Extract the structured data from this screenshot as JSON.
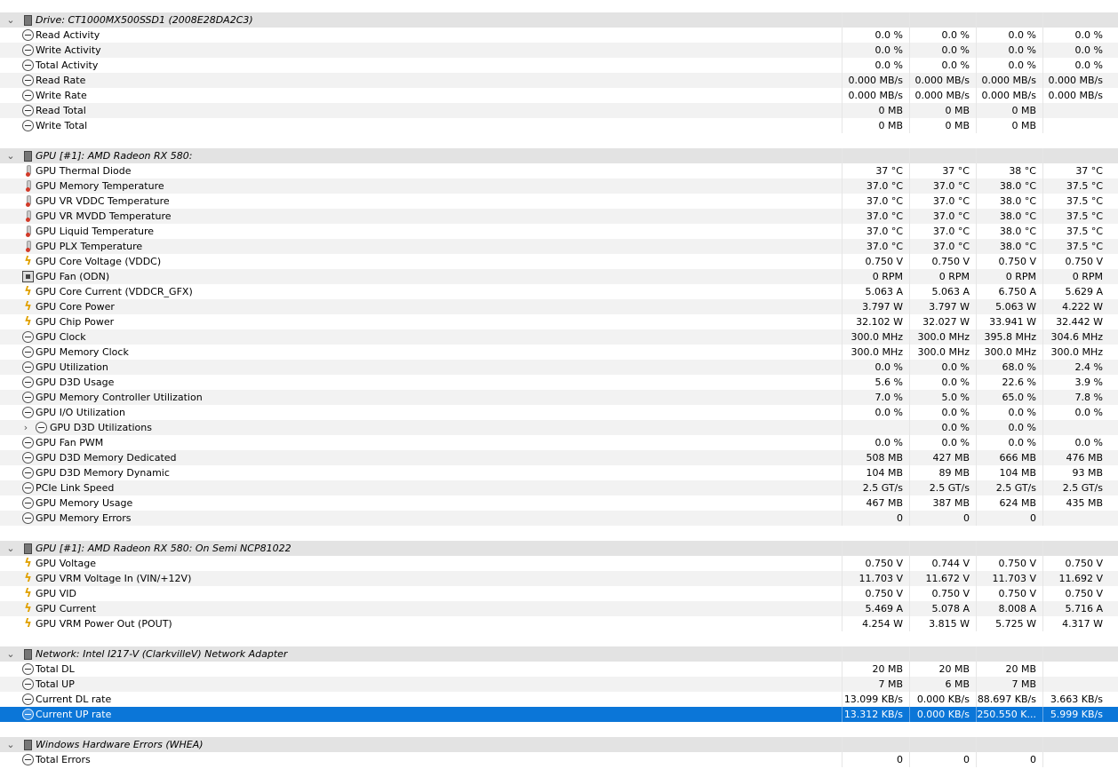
{
  "table": {
    "rows": [
      {
        "type": "group",
        "label": "Drive: CT1000MX500SSD1 (2008E28DA2C3)",
        "icon": "drive-icon",
        "values": [
          "",
          "",
          "",
          ""
        ]
      },
      {
        "type": "item",
        "label": "Read Activity",
        "icon": "gauge-icon",
        "values": [
          "0.0 %",
          "0.0 %",
          "0.0 %",
          "0.0 %"
        ]
      },
      {
        "type": "item",
        "label": "Write Activity",
        "icon": "gauge-icon",
        "values": [
          "0.0 %",
          "0.0 %",
          "0.0 %",
          "0.0 %"
        ]
      },
      {
        "type": "item",
        "label": "Total Activity",
        "icon": "gauge-icon",
        "values": [
          "0.0 %",
          "0.0 %",
          "0.0 %",
          "0.0 %"
        ]
      },
      {
        "type": "item",
        "label": "Read Rate",
        "icon": "gauge-icon",
        "values": [
          "0.000 MB/s",
          "0.000 MB/s",
          "0.000 MB/s",
          "0.000 MB/s"
        ]
      },
      {
        "type": "item",
        "label": "Write Rate",
        "icon": "gauge-icon",
        "values": [
          "0.000 MB/s",
          "0.000 MB/s",
          "0.000 MB/s",
          "0.000 MB/s"
        ]
      },
      {
        "type": "item",
        "label": "Read Total",
        "icon": "gauge-icon",
        "values": [
          "0 MB",
          "0 MB",
          "0 MB",
          ""
        ]
      },
      {
        "type": "item",
        "label": "Write Total",
        "icon": "gauge-icon",
        "values": [
          "0 MB",
          "0 MB",
          "0 MB",
          ""
        ]
      },
      {
        "type": "blank"
      },
      {
        "type": "group",
        "label": "GPU [#1]: AMD Radeon RX 580:",
        "icon": "gpu-chip-icon",
        "values": [
          "",
          "",
          "",
          ""
        ]
      },
      {
        "type": "item",
        "label": "GPU Thermal Diode",
        "icon": "thermometer-icon",
        "values": [
          "37 °C",
          "37 °C",
          "38 °C",
          "37 °C"
        ]
      },
      {
        "type": "item",
        "label": "GPU Memory Temperature",
        "icon": "thermometer-icon",
        "values": [
          "37.0 °C",
          "37.0 °C",
          "38.0 °C",
          "37.5 °C"
        ]
      },
      {
        "type": "item",
        "label": "GPU VR VDDC Temperature",
        "icon": "thermometer-icon",
        "values": [
          "37.0 °C",
          "37.0 °C",
          "38.0 °C",
          "37.5 °C"
        ]
      },
      {
        "type": "item",
        "label": "GPU VR MVDD Temperature",
        "icon": "thermometer-icon",
        "values": [
          "37.0 °C",
          "37.0 °C",
          "38.0 °C",
          "37.5 °C"
        ]
      },
      {
        "type": "item",
        "label": "GPU Liquid Temperature",
        "icon": "thermometer-icon",
        "values": [
          "37.0 °C",
          "37.0 °C",
          "38.0 °C",
          "37.5 °C"
        ]
      },
      {
        "type": "item",
        "label": "GPU PLX Temperature",
        "icon": "thermometer-icon",
        "values": [
          "37.0 °C",
          "37.0 °C",
          "38.0 °C",
          "37.5 °C"
        ]
      },
      {
        "type": "item",
        "label": "GPU Core Voltage (VDDC)",
        "icon": "bolt-icon",
        "values": [
          "0.750 V",
          "0.750 V",
          "0.750 V",
          "0.750 V"
        ]
      },
      {
        "type": "item",
        "label": "GPU Fan (ODN)",
        "icon": "fan-icon",
        "values": [
          "0 RPM",
          "0 RPM",
          "0 RPM",
          "0 RPM"
        ]
      },
      {
        "type": "item",
        "label": "GPU Core Current (VDDCR_GFX)",
        "icon": "bolt-icon",
        "values": [
          "5.063 A",
          "5.063 A",
          "6.750 A",
          "5.629 A"
        ]
      },
      {
        "type": "item",
        "label": "GPU Core Power",
        "icon": "bolt-icon",
        "values": [
          "3.797 W",
          "3.797 W",
          "5.063 W",
          "4.222 W"
        ]
      },
      {
        "type": "item",
        "label": "GPU Chip Power",
        "icon": "bolt-icon",
        "values": [
          "32.102 W",
          "32.027 W",
          "33.941 W",
          "32.442 W"
        ]
      },
      {
        "type": "item",
        "label": "GPU Clock",
        "icon": "gauge-icon",
        "values": [
          "300.0 MHz",
          "300.0 MHz",
          "395.8 MHz",
          "304.6 MHz"
        ]
      },
      {
        "type": "item",
        "label": "GPU Memory Clock",
        "icon": "gauge-icon",
        "values": [
          "300.0 MHz",
          "300.0 MHz",
          "300.0 MHz",
          "300.0 MHz"
        ]
      },
      {
        "type": "item",
        "label": "GPU Utilization",
        "icon": "gauge-icon",
        "values": [
          "0.0 %",
          "0.0 %",
          "68.0 %",
          "2.4 %"
        ]
      },
      {
        "type": "item",
        "label": "GPU D3D Usage",
        "icon": "gauge-icon",
        "values": [
          "5.6 %",
          "0.0 %",
          "22.6 %",
          "3.9 %"
        ]
      },
      {
        "type": "item",
        "label": "GPU Memory Controller Utilization",
        "icon": "gauge-icon",
        "values": [
          "7.0 %",
          "5.0 %",
          "65.0 %",
          "7.8 %"
        ]
      },
      {
        "type": "item",
        "label": "GPU I/O Utilization",
        "icon": "gauge-icon",
        "values": [
          "0.0 %",
          "0.0 %",
          "0.0 %",
          "0.0 %"
        ]
      },
      {
        "type": "sub",
        "label": "GPU D3D Utilizations",
        "icon": "gauge-icon",
        "values": [
          "",
          "0.0 %",
          "0.0 %",
          ""
        ]
      },
      {
        "type": "item",
        "label": "GPU Fan PWM",
        "icon": "gauge-icon",
        "values": [
          "0.0 %",
          "0.0 %",
          "0.0 %",
          "0.0 %"
        ]
      },
      {
        "type": "item",
        "label": "GPU D3D Memory Dedicated",
        "icon": "gauge-icon",
        "values": [
          "508 MB",
          "427 MB",
          "666 MB",
          "476 MB"
        ]
      },
      {
        "type": "item",
        "label": "GPU D3D Memory Dynamic",
        "icon": "gauge-icon",
        "values": [
          "104 MB",
          "89 MB",
          "104 MB",
          "93 MB"
        ]
      },
      {
        "type": "item",
        "label": "PCIe Link Speed",
        "icon": "gauge-icon",
        "values": [
          "2.5 GT/s",
          "2.5 GT/s",
          "2.5 GT/s",
          "2.5 GT/s"
        ]
      },
      {
        "type": "item",
        "label": "GPU Memory Usage",
        "icon": "gauge-icon",
        "values": [
          "467 MB",
          "387 MB",
          "624 MB",
          "435 MB"
        ]
      },
      {
        "type": "item",
        "label": "GPU Memory Errors",
        "icon": "gauge-icon",
        "values": [
          "0",
          "0",
          "0",
          ""
        ]
      },
      {
        "type": "blank"
      },
      {
        "type": "group",
        "label": "GPU [#1]: AMD Radeon RX 580: On Semi NCP81022",
        "icon": "gpu-chip-icon",
        "values": [
          "",
          "",
          "",
          ""
        ]
      },
      {
        "type": "item",
        "label": "GPU Voltage",
        "icon": "bolt-icon",
        "values": [
          "0.750 V",
          "0.744 V",
          "0.750 V",
          "0.750 V"
        ]
      },
      {
        "type": "item",
        "label": "GPU VRM Voltage In (VIN/+12V)",
        "icon": "bolt-icon",
        "values": [
          "11.703 V",
          "11.672 V",
          "11.703 V",
          "11.692 V"
        ]
      },
      {
        "type": "item",
        "label": "GPU VID",
        "icon": "bolt-icon",
        "values": [
          "0.750 V",
          "0.750 V",
          "0.750 V",
          "0.750 V"
        ]
      },
      {
        "type": "item",
        "label": "GPU Current",
        "icon": "bolt-icon",
        "values": [
          "5.469 A",
          "5.078 A",
          "8.008 A",
          "5.716 A"
        ]
      },
      {
        "type": "item",
        "label": "GPU VRM Power Out (POUT)",
        "icon": "bolt-icon",
        "values": [
          "4.254 W",
          "3.815 W",
          "5.725 W",
          "4.317 W"
        ]
      },
      {
        "type": "blank"
      },
      {
        "type": "group",
        "label": "Network: Intel I217-V (ClarkvilleV) Network Adapter",
        "icon": "network-icon",
        "values": [
          "",
          "",
          "",
          ""
        ]
      },
      {
        "type": "item",
        "label": "Total DL",
        "icon": "gauge-icon",
        "values": [
          "20 MB",
          "20 MB",
          "20 MB",
          ""
        ]
      },
      {
        "type": "item",
        "label": "Total UP",
        "icon": "gauge-icon",
        "values": [
          "7 MB",
          "6 MB",
          "7 MB",
          ""
        ]
      },
      {
        "type": "item",
        "label": "Current DL rate",
        "icon": "gauge-icon",
        "values": [
          "13.099 KB/s",
          "0.000 KB/s",
          "88.697 KB/s",
          "3.663 KB/s"
        ]
      },
      {
        "type": "item",
        "label": "Current UP rate",
        "icon": "gauge-icon",
        "selected": true,
        "values": [
          "13.312 KB/s",
          "0.000 KB/s",
          "250.550 K...",
          "5.999 KB/s"
        ]
      },
      {
        "type": "blank"
      },
      {
        "type": "group",
        "label": "Windows Hardware Errors (WHEA)",
        "icon": "whea-icon",
        "values": [
          "",
          "",
          "",
          ""
        ]
      },
      {
        "type": "item",
        "label": "Total Errors",
        "icon": "gauge-icon",
        "values": [
          "0",
          "0",
          "0",
          ""
        ]
      }
    ]
  },
  "colors": {
    "selection": "#0b76d8",
    "group_row": "#e3e3e3",
    "alt_row": "#f2f2f2"
  }
}
